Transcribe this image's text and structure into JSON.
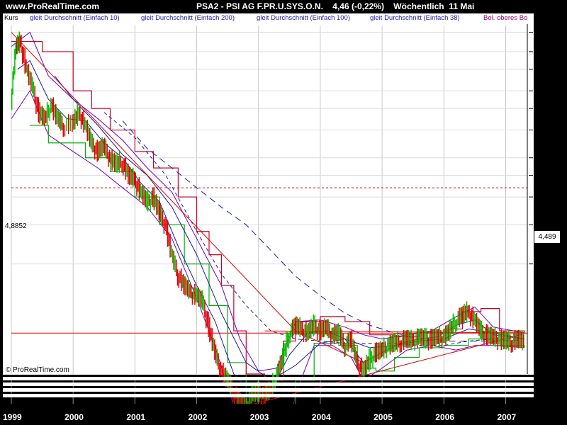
{
  "header": {
    "site": "www.ProRealTime.com",
    "title": "PSA2 - PSI AG F.PR.U.SYS.O.N.    4,46 (-0,22%)    Wöchentlich  11 Mai"
  },
  "legend": [
    {
      "label": "Kurs",
      "color": "#000000"
    },
    {
      "label": "gleit Durchschnitt (Einfach 10)",
      "color": "#2222aa"
    },
    {
      "label": "gleit Durchschnitt (Einfach 200)",
      "color": "#2222aa"
    },
    {
      "label": "gleit Durchschnitt (Einfach 100)",
      "color": "#2222aa"
    },
    {
      "label": "gleit Durchschnitt (Einfach 38)",
      "color": "#2222aa"
    },
    {
      "label": "Bol. oberes Bo",
      "color": "#9b006e"
    }
  ],
  "copyright": "© ProRealTime.com",
  "price_label": "4,489",
  "ref_value_label": "4,8852",
  "colors": {
    "up": "#00c000",
    "down": "#e00000",
    "ma": "#1a1aa0",
    "boll": "#6a00c8",
    "trend": "#e00000",
    "channel_hi": "#cc0020",
    "channel_lo": "#00b000"
  },
  "chart_data": {
    "type": "line",
    "y_scale": "log",
    "ylim": [
      3.2,
      118
    ],
    "y_ticks": [
      110,
      90,
      75,
      60,
      50,
      40,
      30,
      25,
      20,
      15,
      10
    ],
    "x_tick_labels": [
      "1999",
      "2000",
      "2001",
      "2002",
      "2003",
      "2004",
      "2005",
      "2006",
      "2007"
    ],
    "reference_lines": [
      {
        "value": 4.8852,
        "style": "solid",
        "color": "#e00000"
      },
      {
        "value": 22,
        "style": "dotted",
        "color": "#e00000"
      }
    ],
    "series": [
      {
        "role": "close",
        "points": [
          [
            1999.0,
            55
          ],
          [
            1999.08,
            95
          ],
          [
            1999.15,
            100
          ],
          [
            1999.25,
            75
          ],
          [
            1999.35,
            62
          ],
          [
            1999.45,
            48
          ],
          [
            1999.55,
            45
          ],
          [
            1999.65,
            52
          ],
          [
            1999.75,
            45
          ],
          [
            1999.85,
            42
          ],
          [
            2000.0,
            43
          ],
          [
            2000.1,
            48
          ],
          [
            2000.2,
            42
          ],
          [
            2000.3,
            35
          ],
          [
            2000.4,
            32
          ],
          [
            2000.5,
            34
          ],
          [
            2000.6,
            30
          ],
          [
            2000.7,
            28
          ],
          [
            2000.8,
            29
          ],
          [
            2000.9,
            25
          ],
          [
            2001.0,
            24
          ],
          [
            2001.1,
            21
          ],
          [
            2001.2,
            19
          ],
          [
            2001.3,
            20
          ],
          [
            2001.4,
            17
          ],
          [
            2001.5,
            15
          ],
          [
            2001.6,
            11
          ],
          [
            2001.7,
            9
          ],
          [
            2001.8,
            8
          ],
          [
            2001.9,
            7.5
          ],
          [
            2002.0,
            7.2
          ],
          [
            2002.1,
            6.8
          ],
          [
            2002.2,
            5.2
          ],
          [
            2002.3,
            4.0
          ],
          [
            2002.4,
            3.3
          ],
          [
            2002.5,
            3.0
          ],
          [
            2002.6,
            2.7
          ],
          [
            2002.7,
            2.4
          ],
          [
            2002.8,
            2.3
          ],
          [
            2002.9,
            2.6
          ],
          [
            2003.0,
            2.65
          ],
          [
            2003.1,
            2.6
          ],
          [
            2003.2,
            2.7
          ],
          [
            2003.3,
            3.2
          ],
          [
            2003.4,
            3.8
          ],
          [
            2003.5,
            4.9
          ],
          [
            2003.6,
            5.3
          ],
          [
            2003.7,
            5.1
          ],
          [
            2003.8,
            4.9
          ],
          [
            2003.9,
            5.3
          ],
          [
            2004.0,
            5.0
          ],
          [
            2004.1,
            5.2
          ],
          [
            2004.2,
            4.8
          ],
          [
            2004.3,
            4.9
          ],
          [
            2004.4,
            4.3
          ],
          [
            2004.5,
            4.6
          ],
          [
            2004.6,
            3.6
          ],
          [
            2004.7,
            3.3
          ],
          [
            2004.8,
            3.7
          ],
          [
            2004.9,
            4.0
          ],
          [
            2005.0,
            4.1
          ],
          [
            2005.1,
            4.3
          ],
          [
            2005.2,
            4.4
          ],
          [
            2005.3,
            4.5
          ],
          [
            2005.4,
            4.6
          ],
          [
            2005.5,
            4.5
          ],
          [
            2005.6,
            4.7
          ],
          [
            2005.7,
            4.6
          ],
          [
            2005.8,
            4.6
          ],
          [
            2005.9,
            4.7
          ],
          [
            2006.0,
            4.7
          ],
          [
            2006.1,
            5.0
          ],
          [
            2006.2,
            5.6
          ],
          [
            2006.3,
            5.9
          ],
          [
            2006.4,
            6.1
          ],
          [
            2006.5,
            5.6
          ],
          [
            2006.6,
            5.0
          ],
          [
            2006.7,
            4.8
          ],
          [
            2006.8,
            4.7
          ],
          [
            2006.9,
            4.6
          ],
          [
            2007.0,
            4.5
          ],
          [
            2007.1,
            4.5
          ],
          [
            2007.2,
            4.6
          ],
          [
            2007.3,
            4.46
          ]
        ]
      },
      {
        "role": "ma200",
        "name": "gleit Durchschnitt (Einfach 200)",
        "style": "dashed",
        "points": [
          [
            2000.8,
            44
          ],
          [
            2001.2,
            33
          ],
          [
            2001.6,
            27
          ],
          [
            2002.0,
            22
          ],
          [
            2002.4,
            18
          ],
          [
            2002.8,
            15
          ],
          [
            2003.2,
            11.5
          ],
          [
            2003.6,
            8.8
          ],
          [
            2004.0,
            7.2
          ],
          [
            2004.4,
            6.0
          ],
          [
            2004.8,
            5.3
          ],
          [
            2005.2,
            4.9
          ],
          [
            2005.6,
            4.6
          ],
          [
            2006.0,
            4.5
          ],
          [
            2006.4,
            4.5
          ],
          [
            2006.8,
            4.5
          ],
          [
            2007.3,
            4.55
          ]
        ]
      },
      {
        "role": "ma100",
        "name": "gleit Durchschnitt (Einfach 100)",
        "style": "dashed",
        "points": [
          [
            2000.5,
            48
          ],
          [
            2001.0,
            37
          ],
          [
            2001.5,
            25
          ],
          [
            2002.0,
            14
          ],
          [
            2002.4,
            9
          ],
          [
            2002.8,
            6.5
          ],
          [
            2003.2,
            5.0
          ],
          [
            2003.6,
            4.6
          ],
          [
            2004.0,
            4.5
          ],
          [
            2004.4,
            4.4
          ],
          [
            2004.8,
            4.4
          ],
          [
            2005.2,
            4.4
          ],
          [
            2005.6,
            4.3
          ],
          [
            2006.0,
            4.3
          ],
          [
            2006.4,
            4.5
          ],
          [
            2006.8,
            4.6
          ],
          [
            2007.3,
            4.6
          ]
        ]
      },
      {
        "role": "ma38",
        "name": "gleit Durchschnitt (Einfach 38)",
        "style": "solid",
        "points": [
          [
            1999.7,
            70
          ],
          [
            2000.0,
            55
          ],
          [
            2000.4,
            42
          ],
          [
            2000.8,
            31
          ],
          [
            2001.2,
            25
          ],
          [
            2001.6,
            18
          ],
          [
            2002.0,
            11
          ],
          [
            2002.4,
            6.0
          ],
          [
            2002.8,
            3.6
          ],
          [
            2003.2,
            3.0
          ],
          [
            2003.6,
            3.5
          ],
          [
            2004.0,
            4.4
          ],
          [
            2004.4,
            4.6
          ],
          [
            2004.8,
            4.2
          ],
          [
            2005.2,
            4.3
          ],
          [
            2005.6,
            4.5
          ],
          [
            2006.0,
            4.6
          ],
          [
            2006.4,
            5.1
          ],
          [
            2006.8,
            4.9
          ],
          [
            2007.3,
            4.6
          ]
        ]
      },
      {
        "role": "ma10",
        "name": "gleit Durchschnitt (Einfach 10)",
        "style": "solid",
        "points": [
          [
            1999.1,
            75
          ],
          [
            1999.3,
            82
          ],
          [
            1999.6,
            55
          ],
          [
            1999.9,
            45
          ],
          [
            2000.2,
            44
          ],
          [
            2000.5,
            35
          ],
          [
            2000.8,
            30
          ],
          [
            2001.1,
            23
          ],
          [
            2001.4,
            19
          ],
          [
            2001.7,
            12
          ],
          [
            2002.0,
            8
          ],
          [
            2002.3,
            5.5
          ],
          [
            2002.6,
            3.2
          ],
          [
            2002.9,
            2.6
          ],
          [
            2003.2,
            2.7
          ],
          [
            2003.5,
            3.9
          ],
          [
            2003.8,
            4.9
          ],
          [
            2004.1,
            5.0
          ],
          [
            2004.4,
            4.6
          ],
          [
            2004.7,
            3.6
          ],
          [
            2005.0,
            4.0
          ],
          [
            2005.3,
            4.4
          ],
          [
            2005.6,
            4.6
          ],
          [
            2005.9,
            4.7
          ],
          [
            2006.2,
            5.3
          ],
          [
            2006.5,
            5.6
          ],
          [
            2006.8,
            4.8
          ],
          [
            2007.3,
            4.6
          ]
        ]
      },
      {
        "role": "boll_upper",
        "name": "Bol. oberes Bo",
        "style": "solid",
        "points": [
          [
            1999.0,
            95
          ],
          [
            1999.3,
            110
          ],
          [
            1999.6,
            70
          ],
          [
            2000.0,
            55
          ],
          [
            2000.4,
            45
          ],
          [
            2000.8,
            36
          ],
          [
            2001.2,
            27
          ],
          [
            2001.6,
            21
          ],
          [
            2002.0,
            13
          ],
          [
            2002.4,
            8
          ],
          [
            2002.7,
            4.6
          ],
          [
            2003.0,
            3.3
          ],
          [
            2003.3,
            3.4
          ],
          [
            2003.6,
            5.5
          ],
          [
            2004.0,
            5.6
          ],
          [
            2004.4,
            5.2
          ],
          [
            2004.7,
            4.8
          ],
          [
            2005.0,
            4.6
          ],
          [
            2005.4,
            4.8
          ],
          [
            2005.8,
            5.0
          ],
          [
            2006.2,
            5.8
          ],
          [
            2006.5,
            6.4
          ],
          [
            2006.8,
            5.2
          ],
          [
            2007.3,
            4.9
          ]
        ]
      },
      {
        "role": "boll_lower",
        "style": "solid",
        "points": [
          [
            1999.0,
            45
          ],
          [
            1999.3,
            60
          ],
          [
            1999.6,
            38
          ],
          [
            2000.0,
            32
          ],
          [
            2000.4,
            27
          ],
          [
            2000.8,
            22
          ],
          [
            2001.2,
            18
          ],
          [
            2001.6,
            13
          ],
          [
            2002.0,
            7
          ],
          [
            2002.3,
            4.2
          ],
          [
            2002.6,
            2.3
          ],
          [
            2002.9,
            1.9
          ],
          [
            2003.1,
            1.9
          ],
          [
            2003.3,
            1.8
          ],
          [
            2003.45,
            1.6
          ],
          [
            2003.6,
            2.6
          ],
          [
            2003.9,
            4.3
          ],
          [
            2004.2,
            4.3
          ],
          [
            2004.5,
            3.8
          ],
          [
            2004.7,
            3.0
          ],
          [
            2005.0,
            3.4
          ],
          [
            2005.4,
            4.1
          ],
          [
            2005.8,
            4.3
          ],
          [
            2006.2,
            4.1
          ],
          [
            2006.5,
            4.3
          ],
          [
            2006.8,
            4.3
          ],
          [
            2007.3,
            4.2
          ]
        ]
      },
      {
        "role": "channel_hi",
        "style": "step",
        "points": [
          [
            1999.0,
            100
          ],
          [
            1999.5,
            90
          ],
          [
            2000.0,
            60
          ],
          [
            2000.3,
            50
          ],
          [
            2000.6,
            40
          ],
          [
            2001.0,
            32
          ],
          [
            2001.3,
            27
          ],
          [
            2001.7,
            20
          ],
          [
            2002.0,
            14
          ],
          [
            2002.2,
            11
          ],
          [
            2002.4,
            8
          ],
          [
            2002.6,
            5
          ],
          [
            2002.8,
            3.2
          ],
          [
            2003.1,
            3.0
          ],
          [
            2003.4,
            4.5
          ],
          [
            2003.6,
            5.5
          ],
          [
            2004.0,
            5.8
          ],
          [
            2004.4,
            5.5
          ],
          [
            2004.8,
            4.8
          ],
          [
            2005.2,
            4.7
          ],
          [
            2005.6,
            4.9
          ],
          [
            2006.0,
            5.1
          ],
          [
            2006.3,
            6.1
          ],
          [
            2006.6,
            6.3
          ],
          [
            2006.9,
            5.0
          ],
          [
            2007.3,
            4.9
          ]
        ]
      },
      {
        "role": "channel_lo",
        "style": "step",
        "points": [
          [
            1999.3,
            42
          ],
          [
            1999.6,
            35
          ],
          [
            2000.2,
            30
          ],
          [
            2000.6,
            26
          ],
          [
            2001.0,
            20
          ],
          [
            2001.4,
            15
          ],
          [
            2001.8,
            10
          ],
          [
            2002.2,
            6.5
          ],
          [
            2002.5,
            3.6
          ],
          [
            2002.8,
            2.2
          ],
          [
            2003.2,
            2.3
          ],
          [
            2003.6,
            3.0
          ],
          [
            2003.9,
            4.4
          ],
          [
            2004.3,
            4.3
          ],
          [
            2004.6,
            3.4
          ],
          [
            2004.9,
            3.3
          ],
          [
            2005.2,
            3.8
          ],
          [
            2005.6,
            4.2
          ],
          [
            2006.0,
            4.3
          ],
          [
            2006.4,
            4.6
          ],
          [
            2006.8,
            4.3
          ],
          [
            2007.3,
            4.2
          ]
        ]
      },
      {
        "role": "trend",
        "style": "solid",
        "segments": [
          [
            [
              1999.0,
              110
            ],
            [
              2003.6,
              5.0
            ]
          ],
          [
            [
              2003.6,
              5.0
            ],
            [
              2004.7,
              3.6
            ]
          ],
          [
            [
              2002.8,
              2.3
            ],
            [
              2007.3,
              4.85
            ]
          ],
          [
            [
              2003.1,
              5.0
            ],
            [
              2007.3,
              4.9
            ]
          ]
        ]
      }
    ]
  }
}
